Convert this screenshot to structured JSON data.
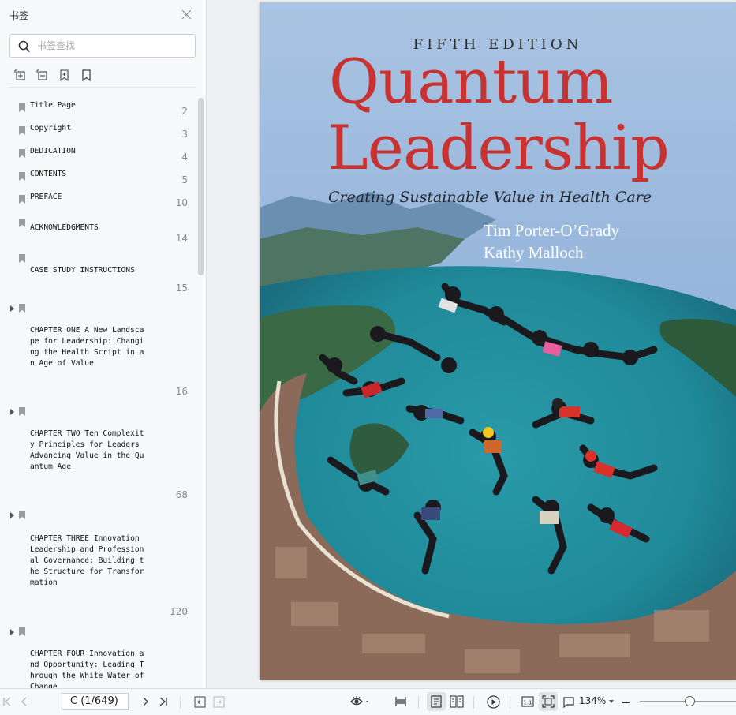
{
  "sidebar": {
    "title": "书签",
    "search_placeholder": "书签查找",
    "tools": [
      "expand-all-icon",
      "collapse-all-icon",
      "add-bookmark-icon",
      "bookmark-icon"
    ],
    "bookmarks": [
      {
        "label": "Title Page",
        "page": "2",
        "expandable": false
      },
      {
        "label": "Copyright",
        "page": "3",
        "expandable": false
      },
      {
        "label": "DEDICATION",
        "page": "4",
        "expandable": false
      },
      {
        "label": "CONTENTS",
        "page": "5",
        "expandable": false
      },
      {
        "label": "PREFACE",
        "page": "10",
        "expandable": false
      },
      {
        "label": "ACKNOWLEDGMENTS",
        "page": "14",
        "expandable": false
      },
      {
        "label": "CASE STUDY INSTRUCTIONS",
        "page": "15",
        "expandable": false
      },
      {
        "label": "CHAPTER ONE A New Landscape for Leadership: Changing the Health Script in an Age of Value",
        "page": "16",
        "expandable": true
      },
      {
        "label": "CHAPTER TWO Ten Complexity Principles for Leaders Advancing Value in the Quantum Age",
        "page": "68",
        "expandable": true
      },
      {
        "label": "CHAPTER THREE Innovation Leadership and Professional Governance: Building the Structure for Transformation",
        "page": "120",
        "expandable": true
      },
      {
        "label": "CHAPTER FOUR Innovation and Opportunity: Leading Through the White Water of Change",
        "page": "",
        "expandable": true
      }
    ]
  },
  "document": {
    "cover": {
      "edition": "FIFTH EDITION",
      "title_line1": "Quantum",
      "title_line2": "Leadership",
      "subtitle": "Creating Sustainable Value in Health Care",
      "authors": [
        "Tim Porter-O’Grady",
        "Kathy Malloch"
      ]
    },
    "colors": {
      "title": "#c83230",
      "sky": "#8fb1d8",
      "sea": "#1f8a9a"
    }
  },
  "toolbar": {
    "page_indicator": "C (1/649)",
    "zoom": "134%",
    "zoom_fraction": 0.52,
    "icons": [
      "first-page-icon",
      "prev-page-icon",
      "next-page-icon",
      "last-page-icon",
      "rotate-left-icon",
      "rotate-right-icon",
      "eye-mode-icon",
      "fit-width-icon",
      "single-page-icon",
      "two-page-icon",
      "play-icon",
      "actual-size-icon",
      "fit-page-icon",
      "page-frame-icon"
    ]
  }
}
